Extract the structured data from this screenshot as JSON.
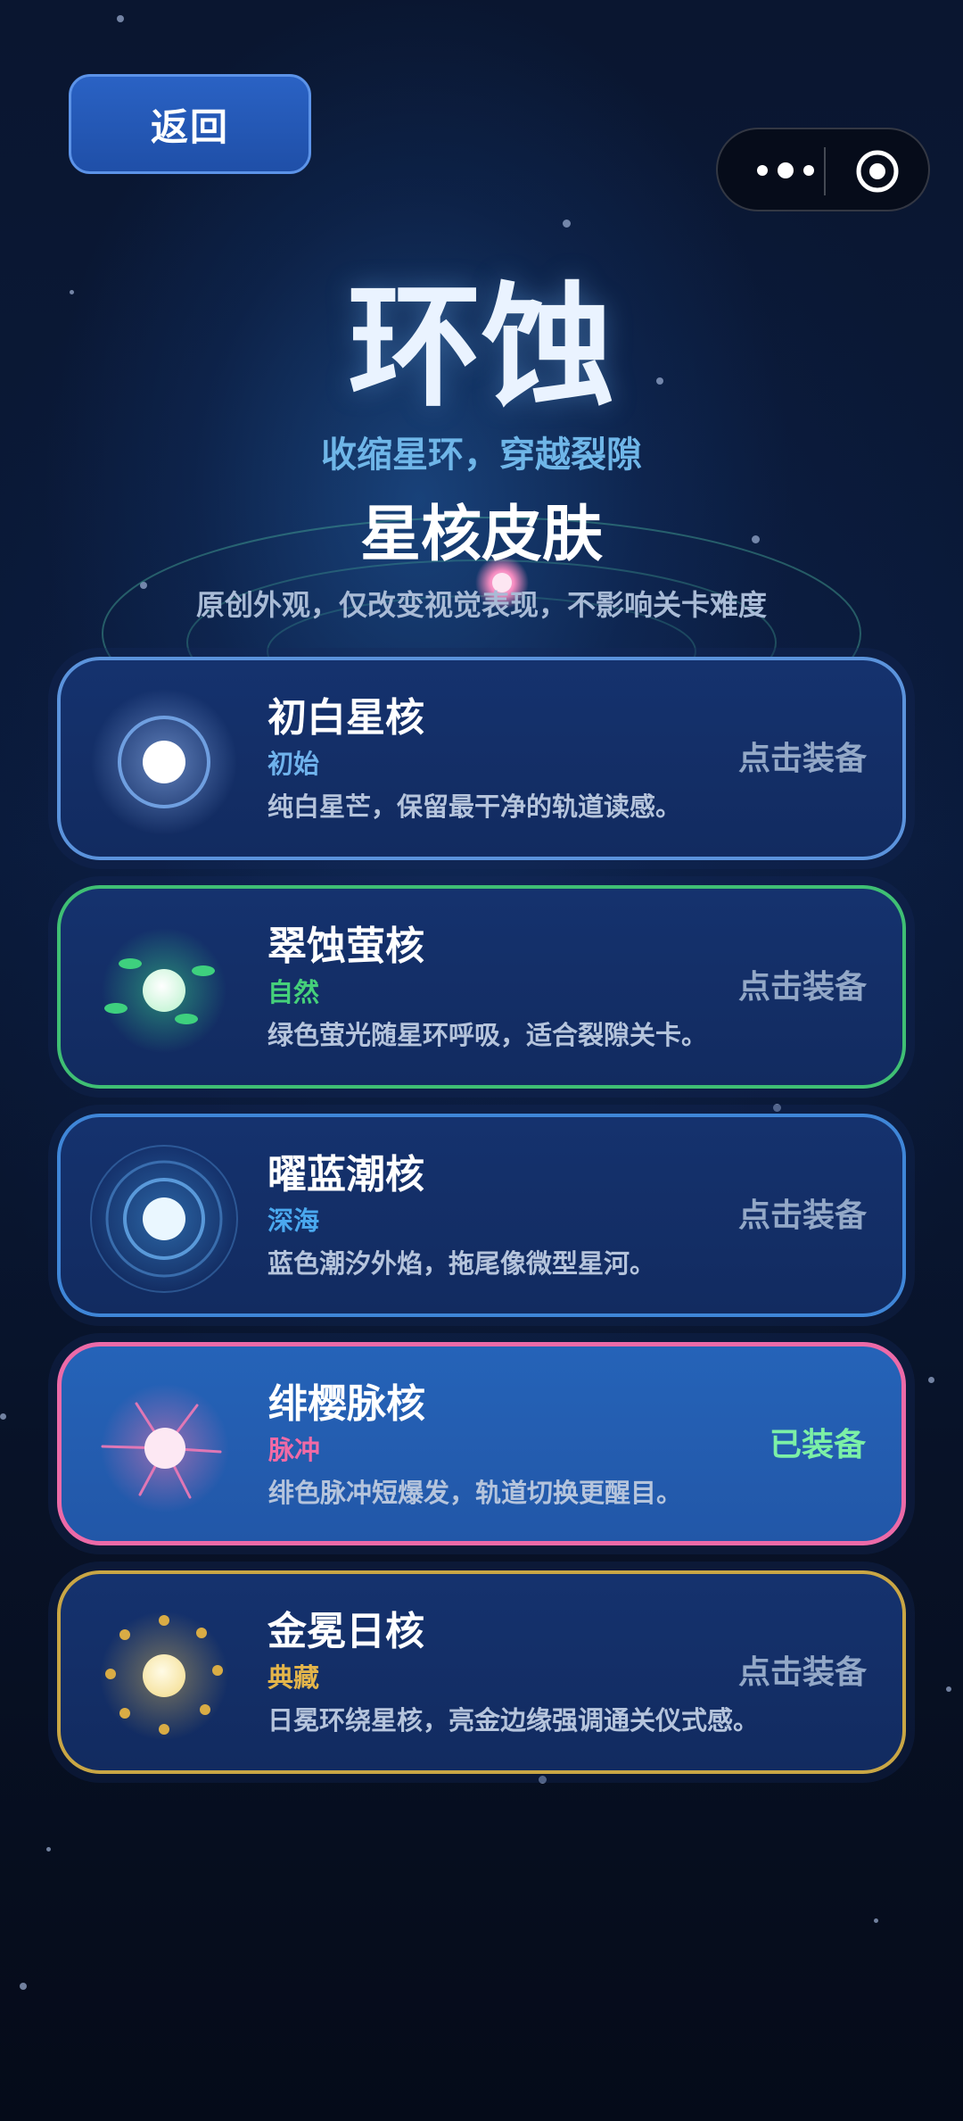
{
  "nav": {
    "back_label": "返回"
  },
  "header": {
    "title": "环蚀",
    "subtitle": "收缩星环，穿越裂隙"
  },
  "section": {
    "title": "星核皮肤",
    "description": "原创外观，仅改变视觉表现，不影响关卡难度"
  },
  "skins": [
    {
      "name": "初白星核",
      "tag": "初始",
      "description": "纯白星芒，保留最干净的轨道读感。",
      "action": "点击装备",
      "equipped": false,
      "icon": "white-core-icon",
      "border_color": "#5b93dc",
      "tag_color": "#6fb2ec"
    },
    {
      "name": "翠蚀萤核",
      "tag": "自然",
      "description": "绿色萤光随星环呼吸，适合裂隙关卡。",
      "action": "点击装备",
      "equipped": false,
      "icon": "green-firefly-core-icon",
      "border_color": "#3fbf74",
      "tag_color": "#45d07a"
    },
    {
      "name": "曜蓝潮核",
      "tag": "深海",
      "description": "蓝色潮汐外焰，拖尾像微型星河。",
      "action": "点击装备",
      "equipped": false,
      "icon": "blue-tide-core-icon",
      "border_color": "#3f86d8",
      "tag_color": "#4aa8ee"
    },
    {
      "name": "绯樱脉核",
      "tag": "脉冲",
      "description": "绯色脉冲短爆发，轨道切换更醒目。",
      "action": "已装备",
      "equipped": true,
      "icon": "pink-pulse-core-icon",
      "border_color": "#ec6aa8",
      "tag_color": "#f06aa6"
    },
    {
      "name": "金冕日核",
      "tag": "典藏",
      "description": "日冕环绕星核，亮金边缘强调通关仪式感。",
      "action": "点击装备",
      "equipped": false,
      "icon": "gold-corona-core-icon",
      "border_color": "#c9a645",
      "tag_color": "#e4b54a"
    }
  ]
}
